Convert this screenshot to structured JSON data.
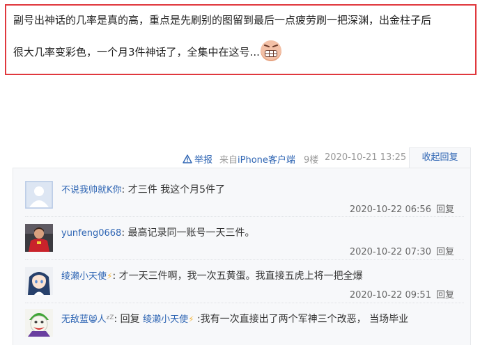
{
  "post": {
    "line1": "副号出神话的几率是真的高，重点是先刷别的图留到最后一点疲劳刷一把深渊，出金柱子后",
    "line2": "很大几率变彩色，一个月3件神话了，全集中在这号...",
    "emoji_icon": "grimace-emoji-icon"
  },
  "meta": {
    "report_label": "举报",
    "source_prefix": "来自",
    "source_device": "iPhone客户端",
    "floor": "9楼",
    "date": "2020-10-21 13:25",
    "collapse_label": "收起回复"
  },
  "replies": [
    {
      "user": "不说我帅就K你",
      "separator": ":",
      "content": "才三件 我这个月5件了",
      "time": "2020-10-22 06:56",
      "reply_label": "回复",
      "avatar_icon": "default-avatar-icon"
    },
    {
      "user": "yunfeng0668",
      "separator": ":",
      "content": "最高记录同一账号一天三件。",
      "time": "2020-10-22 07:30",
      "reply_label": "回复",
      "avatar_icon": "soccer-player-avatar-icon"
    },
    {
      "user": "绫濑小天使",
      "user_badge": "⚡",
      "separator": ":",
      "content": "才一天三件啊，我一次五黄蛋。我直接五虎上将一把全爆",
      "time": "2020-10-22 09:51",
      "reply_label": "回复",
      "avatar_icon": "anime-girl-avatar-icon"
    },
    {
      "user": "无敌蓝",
      "user_badge_cat": "😸",
      "user_suffix": "人",
      "user_zz": "zZ",
      "separator": ":",
      "prefix": "回复",
      "reply_to": "绫濑小天使",
      "reply_to_badge": "⚡",
      "content": ":我有一次直接出了两个军神三个改恶， 当场毕业",
      "avatar_icon": "joker-avatar-icon"
    }
  ],
  "colors": {
    "highlight_border": "#e0383d",
    "link": "#2d64b3",
    "panel_bg": "#f7f8fa"
  }
}
